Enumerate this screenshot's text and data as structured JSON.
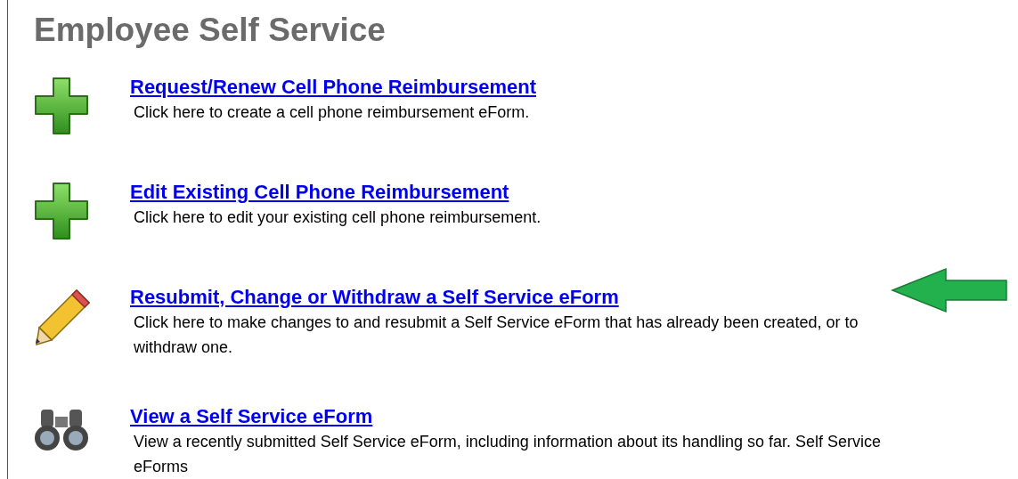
{
  "title": "Employee Self Service",
  "items": [
    {
      "kind": "plus",
      "link": "Request/Renew Cell Phone Reimbursement",
      "description": "Click here to create a cell phone reimbursement eForm."
    },
    {
      "kind": "plus",
      "link": "Edit Existing Cell Phone Reimbursement",
      "description": "Click here to edit your existing cell phone reimbursement."
    },
    {
      "kind": "pencil",
      "link": "Resubmit, Change or Withdraw a Self Service eForm",
      "description": "Click here to make changes to and resubmit a Self Service eForm that has already been created, or to withdraw one."
    },
    {
      "kind": "binoculars",
      "link": "View a Self Service eForm",
      "description": "View a recently submitted Self Service eForm, including information about its handling so far. Self Service eForms"
    }
  ]
}
